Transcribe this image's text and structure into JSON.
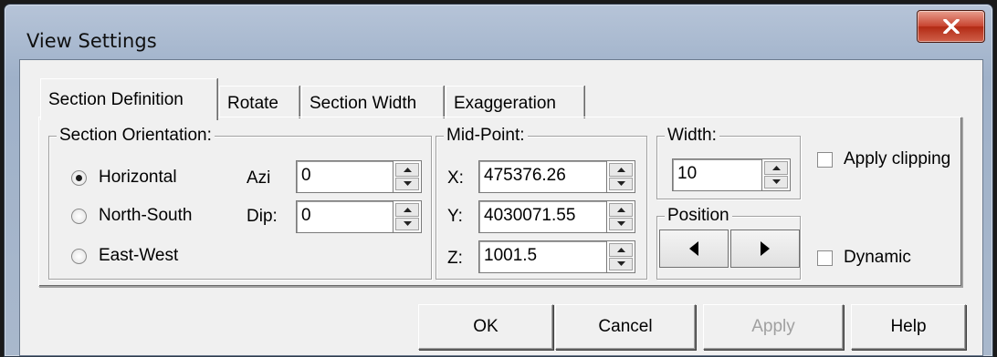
{
  "window": {
    "title": "View Settings"
  },
  "tabs": [
    "Section Definition",
    "Rotate",
    "Section Width",
    "Exaggeration"
  ],
  "orientation": {
    "legend": "Section Orientation:",
    "options": [
      "Horizontal",
      "North-South",
      "East-West"
    ],
    "selected": "Horizontal",
    "azi_label": "Azi",
    "azi_value": "0",
    "dip_label": "Dip:",
    "dip_value": "0"
  },
  "midpoint": {
    "legend": "Mid-Point:",
    "x_label": "X:",
    "x_value": "475376.26",
    "y_label": "Y:",
    "y_value": "4030071.55",
    "z_label": "Z:",
    "z_value": "1001.5"
  },
  "width": {
    "legend": "Width:",
    "value": "10"
  },
  "position": {
    "legend": "Position"
  },
  "options": {
    "apply_clipping": "Apply clipping",
    "dynamic": "Dynamic"
  },
  "buttons": {
    "ok": "OK",
    "cancel": "Cancel",
    "apply": "Apply",
    "help": "Help"
  }
}
